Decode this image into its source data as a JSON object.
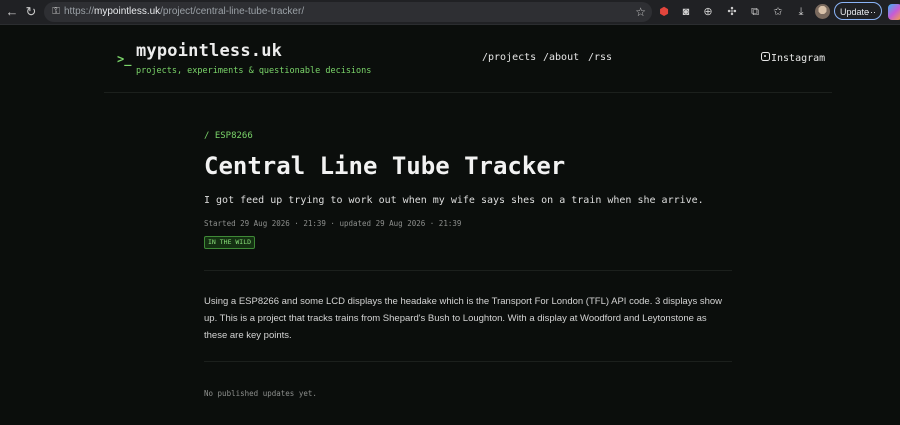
{
  "browser": {
    "url_host": "mypointless.uk",
    "url_prefix": "https://",
    "url_path": "/project/central-line-tube-tracker/",
    "update_label": "Update",
    "update_more": "⋯"
  },
  "site": {
    "prompt": ">_",
    "name": "mypointless.uk",
    "tagline": "projects, experiments & questionable decisions",
    "nav": [
      {
        "label": "/projects"
      },
      {
        "label": "/about"
      },
      {
        "label": "/rss"
      }
    ],
    "instagram_label": "Instagram"
  },
  "project": {
    "breadcrumb": "/ ESP8266",
    "title": "Central Line Tube Tracker",
    "subtitle": "I got feed up trying to work out when my wife says shes on a train when she arrive.",
    "dates": "Started 29 Aug 2026 · 21:39 · updated 29 Aug 2026 · 21:39",
    "status_badge": "IN THE WILD",
    "body": "Using a ESP8266 and some LCD displays the headake which is the Transport For London (TFL) API code. 3 displays show up. This is a project that tracks trains from Shepard's Bush to Loughton. With a display at Woodford and Leytonstone as these are key points.",
    "updates_empty": "No published updates yet."
  },
  "colors": {
    "accent": "#7bd56a",
    "background": "#0b0e0c"
  }
}
